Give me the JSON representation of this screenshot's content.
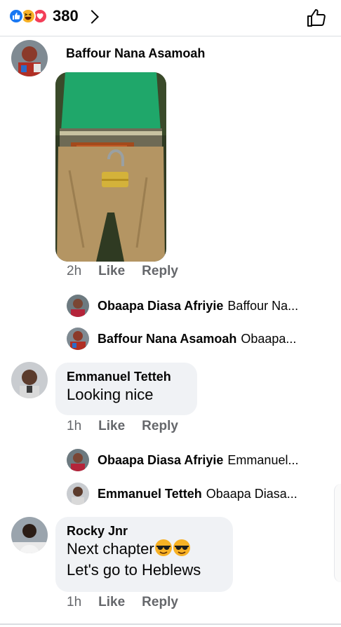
{
  "header": {
    "reaction_icons": [
      "like-icon",
      "haha-icon",
      "love-icon"
    ],
    "reaction_count": "380",
    "like_icon": "thumbs-up-outline-icon"
  },
  "comments": [
    {
      "author": "Baffour Nana Asamoah",
      "has_photo": true,
      "time": "2h",
      "like_label": "Like",
      "reply_label": "Reply",
      "replies": [
        {
          "author": "Obaapa Diasa Afriyie",
          "preview": "Baffour Na..."
        },
        {
          "author": "Baffour Nana Asamoah",
          "preview": "Obaapa..."
        }
      ]
    },
    {
      "author": "Emmanuel Tetteh",
      "text_lines": [
        "Looking nice"
      ],
      "time": "1h",
      "like_label": "Like",
      "reply_label": "Reply",
      "replies": [
        {
          "author": "Obaapa Diasa Afriyie",
          "preview": "Emmanuel..."
        },
        {
          "author": "Emmanuel Tetteh",
          "preview": "Obaapa Diasa..."
        }
      ]
    },
    {
      "author": "Rocky Jnr",
      "text_lines": [
        "Next chapter",
        "Let's go to Heblews"
      ],
      "emoji": "sunglasses-face-icon",
      "time": "1h",
      "like_label": "Like",
      "reply_label": "Reply"
    }
  ],
  "colors": {
    "like_blue": "#1877f2",
    "bubble_bg": "#f0f2f5",
    "meta_gray": "#65676b"
  }
}
